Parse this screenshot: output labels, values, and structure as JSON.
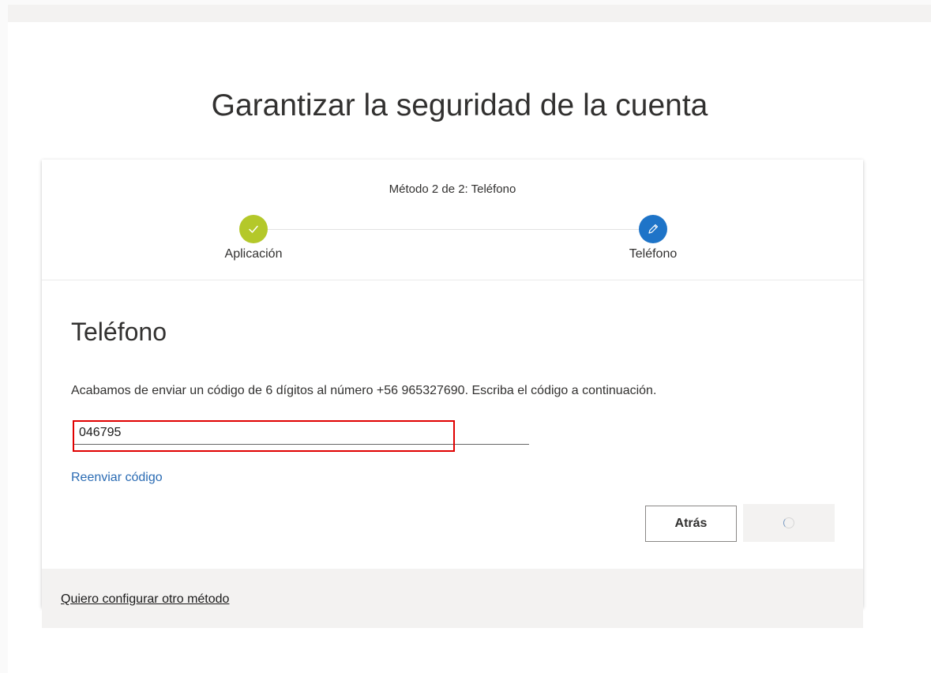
{
  "page": {
    "title": "Garantizar la seguridad de la cuenta"
  },
  "progress": {
    "caption": "Método 2 de 2: Teléfono",
    "steps": [
      {
        "label": "Aplicación",
        "state": "completed",
        "icon": "check-icon",
        "color": "#b4c82a"
      },
      {
        "label": "Teléfono",
        "state": "current",
        "icon": "pencil-icon",
        "color": "#1e74c8"
      }
    ]
  },
  "section": {
    "title": "Teléfono",
    "instructions": "Acabamos de enviar un código de 6 dígitos al número +56 965327690. Escriba el código a continuación.",
    "code_value": "046795",
    "resend_label": "Reenviar código"
  },
  "actions": {
    "back_label": "Atrás",
    "next_state": "loading"
  },
  "footer": {
    "other_method_label": "Quiero configurar otro método"
  },
  "colors": {
    "link": "#2a6bb3",
    "highlight": "#e00000"
  }
}
